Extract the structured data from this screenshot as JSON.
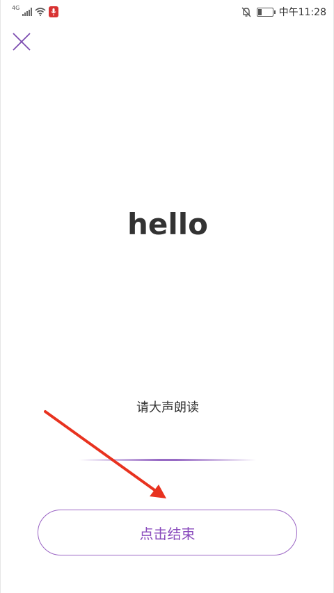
{
  "status_bar": {
    "network": "4G",
    "time": "中午11:28"
  },
  "card": {
    "word": "hello",
    "prompt": "请大声朗读",
    "end_button_label": "点击结束"
  },
  "colors": {
    "accent": "#8a4bbd",
    "arrow": "#e8321f"
  }
}
